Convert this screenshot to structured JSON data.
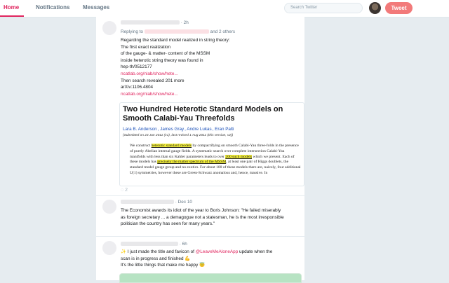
{
  "nav": {
    "home": "Home",
    "notifications": "Notifications",
    "messages": "Messages",
    "search_placeholder": "Search Twitter",
    "tweet_button": "Tweet",
    "accent": "#e0245e"
  },
  "tweet1": {
    "time": "· 2h",
    "replying_prefix": "Replying to",
    "replying_suffix": "and 2 others",
    "lines": [
      "Regarding the standard model realized in string theory:",
      "The first exact realization",
      "of the gauge- & matter- content of the MSSM",
      "inside heterotic string theory was found in",
      "hep-th/0512177"
    ],
    "link1": "ncatlab.org/nlab/show/hete...",
    "line_mid1": "Then search revealed 201 more",
    "line_mid2": "arXiv:1106.4804",
    "link2": "ncatlab.org/nlab/show/hete...",
    "paper": {
      "title": "Two Hundred Heterotic Standard Models on Smooth Calabi-Yau Threefolds",
      "authors": [
        "Lara B. Anderson",
        "James Gray",
        "Andre Lukas",
        "Eran Palti"
      ],
      "submitted": "(Submitted on 23 Jun 2011 (v1), last revised 1 Aug 2011 (this version, v2))",
      "abstract": {
        "a1": "We construct ",
        "h1": "heterotic standard models",
        "a2": " by compactifying on smooth Calabi-Yau three-folds in the presence of purely Abelian internal gauge fields. A systematic search over complete intersection Calabi-Yau manifolds with less than six Kahler parameters leads to over ",
        "h2": "200 such models",
        "a3": " which we present. Each of these models has ",
        "h3": "precisely the matter spectrum of the MSSM",
        "a4": ", at least one pair of Higgs doublets, the standard model gauge group and no exotics. For about 100 of these models there are, naively, four additional U(1) symmetries, however these are Green-Schwarz anomalous and, hence, massive. In"
      }
    },
    "reply_count": "2"
  },
  "tweet2": {
    "time": "· Dec 10",
    "lines": [
      "The Economist awards its idiot of the year to Boris Johnson: \"He failed miserably",
      "as foreign secretary ... a demagogue not a statesman, he is the most irresponsible",
      "politician the country has seen for many years.\""
    ]
  },
  "tweet3": {
    "time": "· 6h",
    "line1_pre": "I just made the title and favicon of",
    "mention": "@LeaveMeAloneApp",
    "line1_post": "update when the",
    "line2": "scan is in progress and finished",
    "line3": "It's the little things that make me happy",
    "sparkle_emoji": "✨",
    "muscle_emoji": "💪",
    "smile_emoji": "😇"
  }
}
